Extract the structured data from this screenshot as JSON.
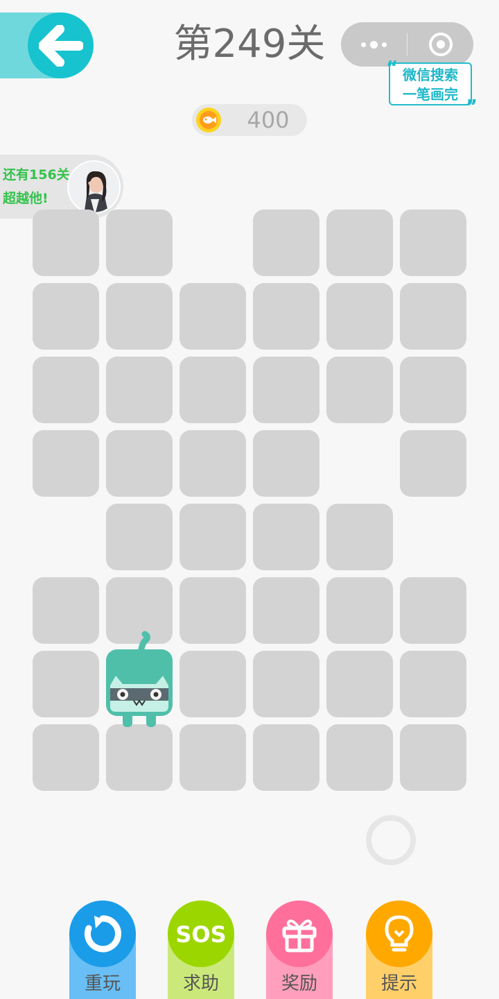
{
  "header": {
    "title": "第249关",
    "back_icon": "back-arrow-icon",
    "menu_icon": "more-dots-icon",
    "close_icon": "target-circle-icon"
  },
  "search_badge": {
    "line1": "微信搜索",
    "line2": "一笔画完"
  },
  "coins": {
    "value": "400",
    "icon": "fish-coin-icon"
  },
  "rival": {
    "line1": "还有156关",
    "line2": "超越他!"
  },
  "grid": {
    "columns": 6,
    "rows": 8,
    "tile_color": "#d3d3d3",
    "layout": [
      "11 111",
      "111111",
      "111111",
      "1111 1",
      " 1111 ",
      "111111",
      "1C1111",
      "111111"
    ],
    "player_cell": {
      "row": 6,
      "col": 1
    },
    "player_color": "#4fbfaa"
  },
  "actions": [
    {
      "label": "重玩",
      "icon": "replay-icon",
      "circle": "#1b9ce8",
      "stem": "#69bff5"
    },
    {
      "label": "求助",
      "icon": "sos-icon",
      "circle": "#9cd600",
      "stem": "#cbe97a"
    },
    {
      "label": "奖励",
      "icon": "gift-icon",
      "circle": "#ff6f9c",
      "stem": "#ff9fbd"
    },
    {
      "label": "提示",
      "icon": "lightbulb-icon",
      "circle": "#ffa800",
      "stem": "#ffcf6a"
    }
  ]
}
